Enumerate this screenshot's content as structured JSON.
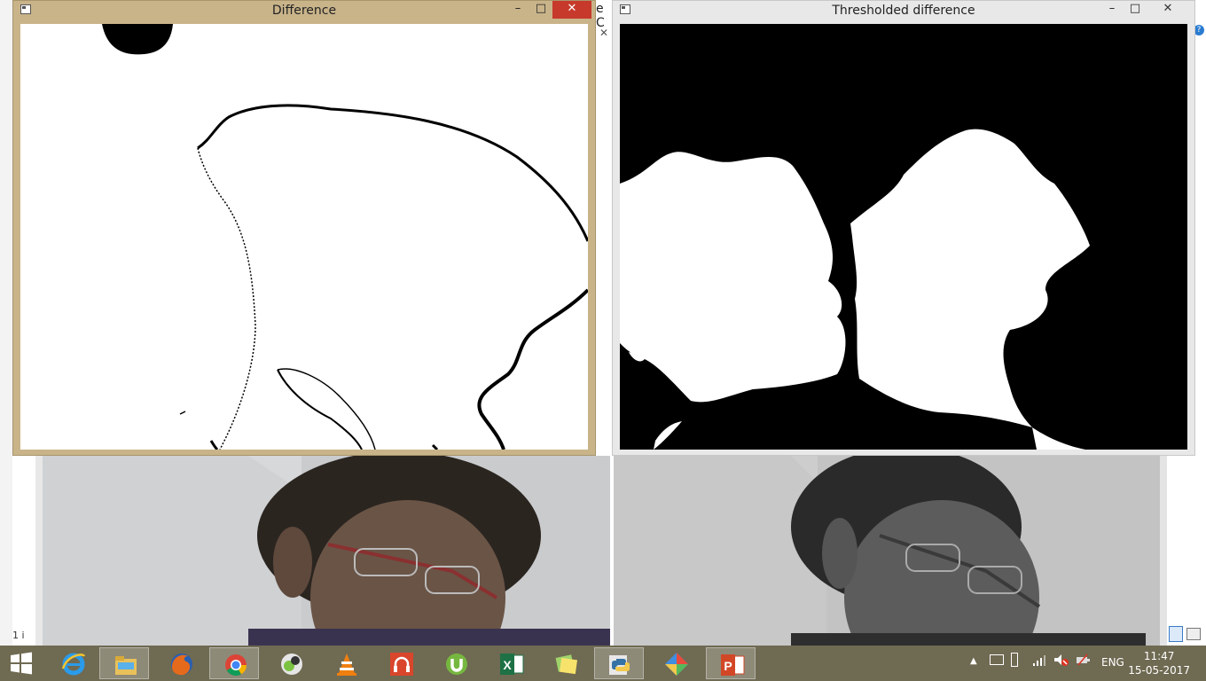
{
  "windows": {
    "difference": {
      "title": "Difference",
      "minimize": "–",
      "maximize": "□",
      "close": "✕"
    },
    "thresholded": {
      "title": "Thresholded difference",
      "minimize": "–",
      "maximize": "□",
      "close": "✕"
    }
  },
  "background": {
    "partial_text_1": "e C",
    "partial_text_2": "1 i"
  },
  "taskbar": {
    "apps": [
      {
        "name": "start-button",
        "icon": "windows-logo-icon"
      },
      {
        "name": "internet-explorer",
        "icon": "ie-icon"
      },
      {
        "name": "file-explorer",
        "icon": "folder-icon"
      },
      {
        "name": "firefox",
        "icon": "firefox-icon"
      },
      {
        "name": "chrome",
        "icon": "chrome-icon"
      },
      {
        "name": "media-app",
        "icon": "media-icon"
      },
      {
        "name": "vlc",
        "icon": "vlc-icon"
      },
      {
        "name": "music-app",
        "icon": "headphones-icon"
      },
      {
        "name": "utorrent",
        "icon": "utorrent-icon"
      },
      {
        "name": "excel",
        "icon": "excel-icon"
      },
      {
        "name": "sticky-notes",
        "icon": "notes-icon"
      },
      {
        "name": "python",
        "icon": "python-icon"
      },
      {
        "name": "app-diamond",
        "icon": "diamond-icon"
      },
      {
        "name": "powerpoint",
        "icon": "powerpoint-icon"
      }
    ],
    "language": "ENG",
    "time": "11:47",
    "date": "15-05-2017"
  },
  "colors": {
    "taskbar": "#6f6a52",
    "active_frame": "#c9b48a",
    "close_red": "#c7392b"
  }
}
